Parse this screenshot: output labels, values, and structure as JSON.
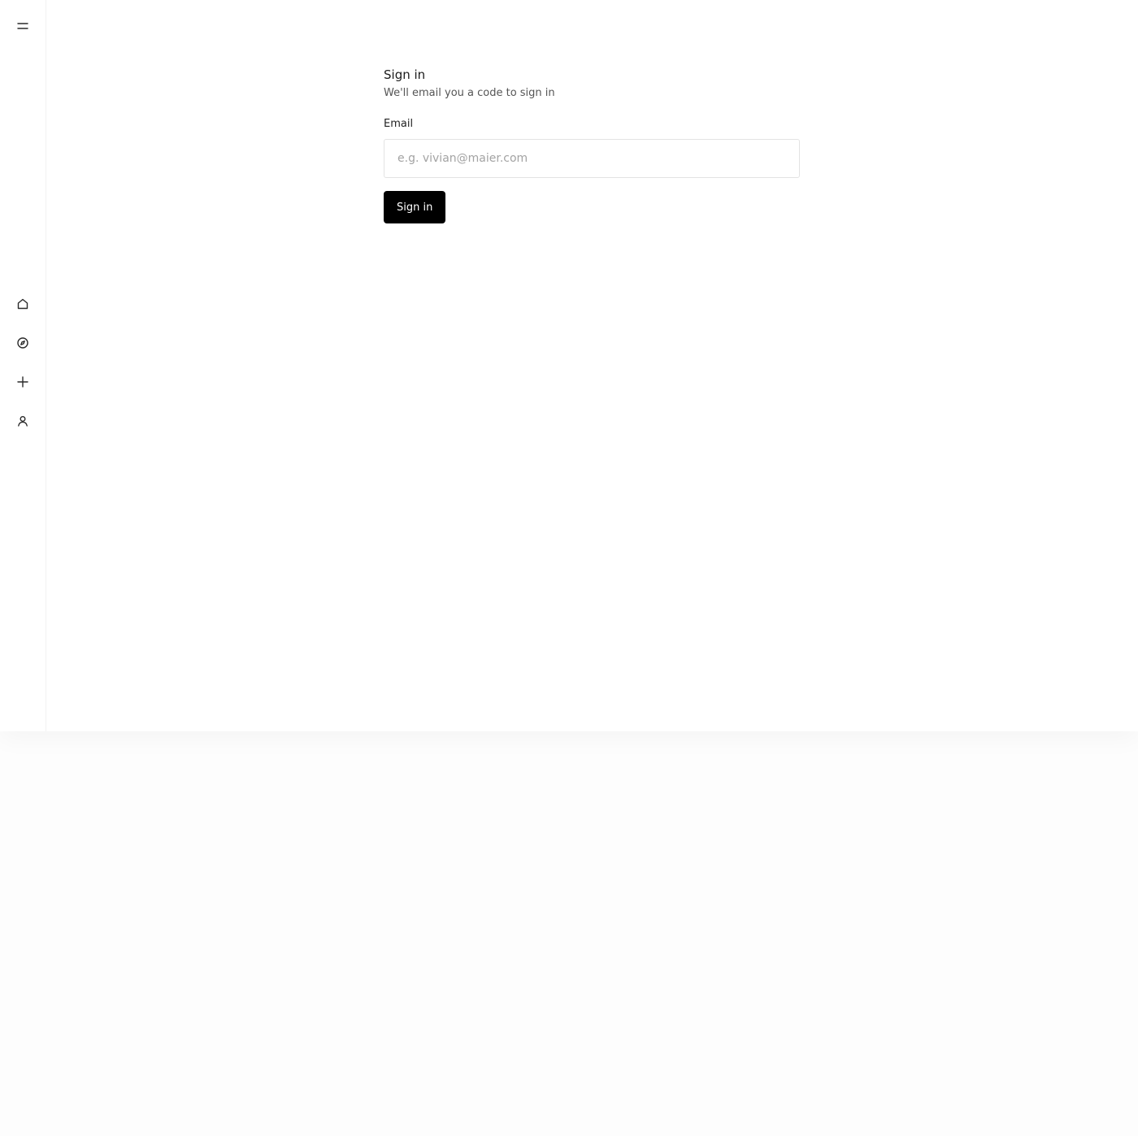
{
  "sidebar": {
    "menu_icon": "menu-icon",
    "nav_items": [
      {
        "id": "home",
        "icon": "home-icon"
      },
      {
        "id": "explore",
        "icon": "compass-icon"
      },
      {
        "id": "create",
        "icon": "plus-icon"
      },
      {
        "id": "profile",
        "icon": "user-icon"
      }
    ]
  },
  "signin": {
    "title": "Sign in",
    "subtitle": "We'll email you a code to sign in",
    "email_label": "Email",
    "email_value": "",
    "email_placeholder": "e.g. vivian@maier.com",
    "submit_label": "Sign in"
  },
  "colors": {
    "primary_button_bg": "#000000",
    "primary_button_text": "#ffffff",
    "input_border": "#e3e3e3",
    "sidebar_border": "#f1f1f1"
  }
}
